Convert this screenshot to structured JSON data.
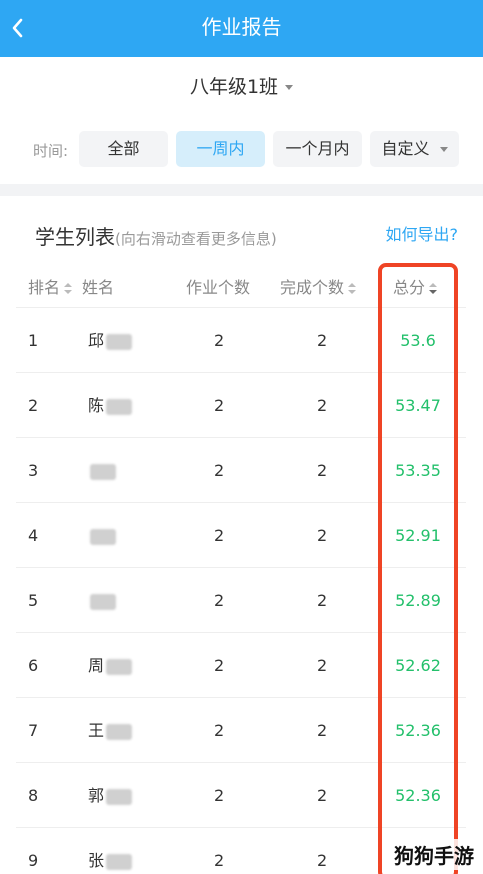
{
  "header": {
    "title": "作业报告",
    "back_icon": "chevron-left-icon"
  },
  "class_selector": {
    "value": "八年级1班"
  },
  "time_filter": {
    "label": "时间:",
    "options": [
      "全部",
      "一周内",
      "一个月内",
      "自定义"
    ],
    "selected": "一周内"
  },
  "student_list": {
    "title": "学生列表",
    "hint": "(向右滑动查看更多信息)",
    "export_link": "如何导出?",
    "columns": {
      "rank": "排名",
      "name": "姓名",
      "homework_count": "作业个数",
      "completed_count": "完成个数",
      "total_score": "总分"
    },
    "rows": [
      {
        "rank": "1",
        "name": "邱",
        "homework_count": "2",
        "completed_count": "2",
        "total_score": "53.6"
      },
      {
        "rank": "2",
        "name": "陈",
        "homework_count": "2",
        "completed_count": "2",
        "total_score": "53.47"
      },
      {
        "rank": "3",
        "name": "",
        "homework_count": "2",
        "completed_count": "2",
        "total_score": "53.35"
      },
      {
        "rank": "4",
        "name": "",
        "homework_count": "2",
        "completed_count": "2",
        "total_score": "52.91"
      },
      {
        "rank": "5",
        "name": "",
        "homework_count": "2",
        "completed_count": "2",
        "total_score": "52.89"
      },
      {
        "rank": "6",
        "name": "周",
        "homework_count": "2",
        "completed_count": "2",
        "total_score": "52.62"
      },
      {
        "rank": "7",
        "name": "王",
        "homework_count": "2",
        "completed_count": "2",
        "total_score": "52.36"
      },
      {
        "rank": "8",
        "name": "郭",
        "homework_count": "2",
        "completed_count": "2",
        "total_score": "52.36"
      },
      {
        "rank": "9",
        "name": "张",
        "homework_count": "2",
        "completed_count": "2",
        "total_score": ""
      }
    ]
  },
  "colors": {
    "brand": "#2ea7f3",
    "score": "#23c06b",
    "highlight": "#ef4425"
  },
  "watermark": "狗狗手游"
}
